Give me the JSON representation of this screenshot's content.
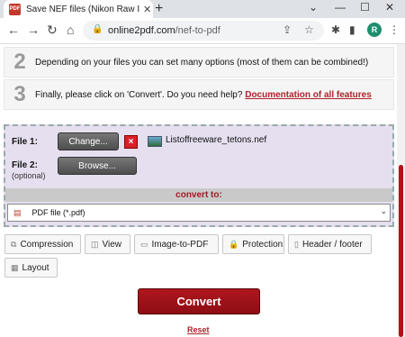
{
  "browser": {
    "tab_title": "Save NEF files (Nikon Raw Image",
    "favicon_text": "PDF",
    "new_tab": "+",
    "url_host": "online2pdf.com",
    "url_path": "/nef-to-pdf",
    "profile_initial": "R",
    "window_controls": [
      "⌄",
      "—",
      "☐",
      "✕"
    ]
  },
  "steps": [
    {
      "number": "2",
      "text": "Depending on your files you can set many options (most of them can be combined!)"
    },
    {
      "number": "3",
      "text": "Finally, please click on 'Convert'. Do you need help?",
      "link": "Documentation of all features"
    }
  ],
  "upload": {
    "file1_label": "File 1:",
    "change_button": "Change...",
    "remove_icon": "x-icon",
    "file1_name": "Listoffreeware_tetons.nef",
    "file2_label": "File 2:",
    "file2_optional": "(optional)",
    "browse_button": "Browse...",
    "convert_to_label": "convert to:",
    "format_selected": "PDF file (*.pdf)"
  },
  "options": [
    "Compression",
    "View",
    "Image-to-PDF",
    "Protection",
    "Header / footer",
    "Layout"
  ],
  "actions": {
    "convert": "Convert",
    "reset": "Reset"
  },
  "colors": {
    "accent": "#b0161e",
    "upload_bg": "#e6dff0"
  }
}
